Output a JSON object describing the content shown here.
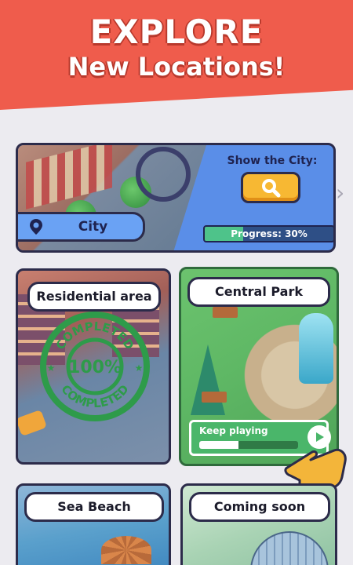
{
  "header": {
    "title": "EXPLORE",
    "subtitle": "New Locations!"
  },
  "city_card": {
    "show_label": "Show the City:",
    "progress_text": "Progress: 30%",
    "progress_fraction": 0.3,
    "city_name": "City"
  },
  "locations": {
    "residential": {
      "label": "Residential area",
      "stamp_top": "COMPLETED",
      "stamp_bottom": "COMPLETED",
      "stamp_percent": "100%"
    },
    "central_park": {
      "label": "Central Park",
      "action": "Keep playing",
      "progress_fraction": 0.4
    },
    "sea_beach": {
      "label": "Sea Beach"
    },
    "coming_soon": {
      "label": "Coming soon"
    }
  },
  "colors": {
    "banner": "#ef5c4c",
    "outline": "#2c2b4a",
    "city_panel": "#5a8ee8",
    "search_button": "#f7b833",
    "progress_fill": "#4ec38a",
    "park_green": "#4ab66a",
    "stamp_green": "#2e9b4a"
  },
  "icons": {
    "search": "search-icon",
    "pin": "location-pin-icon",
    "next": "chevron-right-icon",
    "play": "play-icon",
    "pointer": "pointing-hand-icon"
  }
}
